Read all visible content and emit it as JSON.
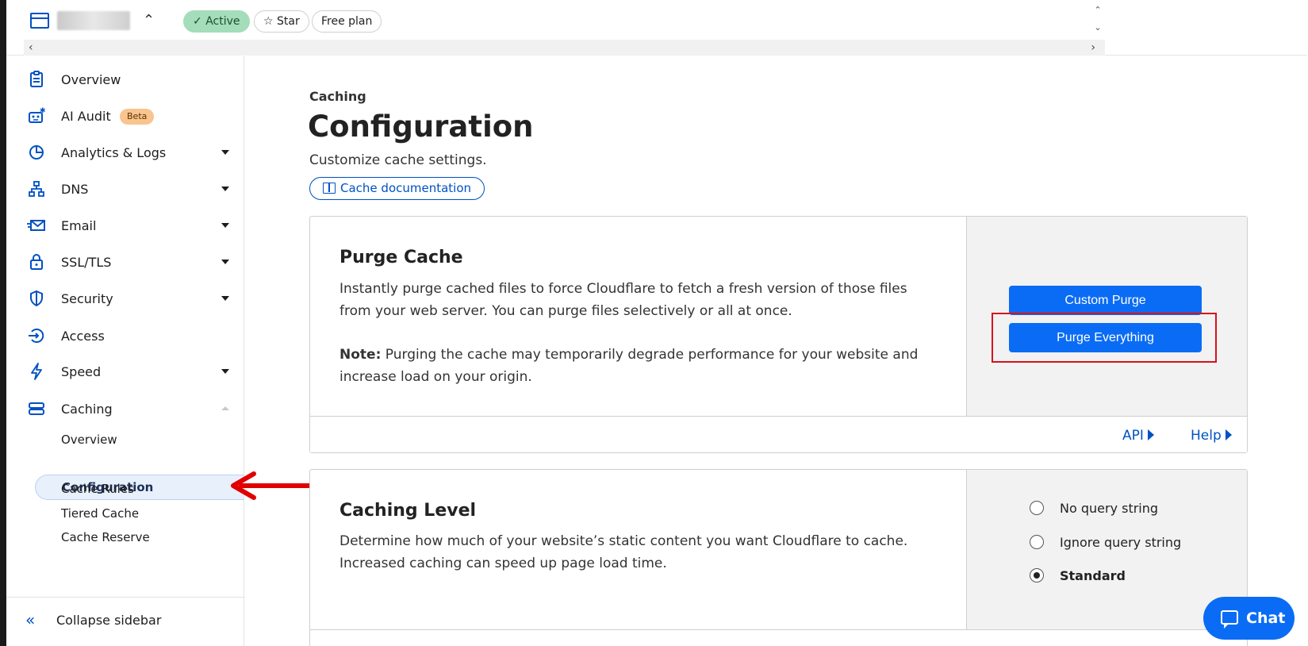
{
  "topbar": {
    "status_label": "Active",
    "star_label": "Star",
    "plan_label": "Free plan"
  },
  "sidebar": {
    "items": [
      {
        "label": "Overview",
        "icon": "clipboard-icon"
      },
      {
        "label": "AI Audit",
        "icon": "robot-icon",
        "badge": "Beta"
      },
      {
        "label": "Analytics & Logs",
        "icon": "pie-chart-icon"
      },
      {
        "label": "DNS",
        "icon": "network-icon"
      },
      {
        "label": "Email",
        "icon": "envelope-icon"
      },
      {
        "label": "SSL/TLS",
        "icon": "lock-icon"
      },
      {
        "label": "Security",
        "icon": "shield-icon"
      },
      {
        "label": "Access",
        "icon": "access-icon"
      },
      {
        "label": "Speed",
        "icon": "lightning-icon"
      },
      {
        "label": "Caching",
        "icon": "server-stack-icon"
      }
    ],
    "caching_sub": [
      "Overview",
      "Configuration",
      "Cache Rules",
      "Tiered Cache",
      "Cache Reserve"
    ],
    "collapse_label": "Collapse sidebar"
  },
  "header": {
    "eyebrow": "Caching",
    "title": "Configuration",
    "subtitle": "Customize cache settings.",
    "doc_button": "Cache documentation"
  },
  "purge_card": {
    "title": "Purge Cache",
    "description": "Instantly purge cached files to force Cloudflare to fetch a fresh version of those files from your web server. You can purge files selectively or all at once.",
    "note_label": "Note:",
    "note_text": " Purging the cache may temporarily degrade performance for your website and increase load on your origin.",
    "custom_purge": "Custom Purge",
    "purge_everything": "Purge Everything",
    "api_link": "API",
    "help_link": "Help"
  },
  "caching_level_card": {
    "title": "Caching Level",
    "description": "Determine how much of your website’s static content you want Cloudflare to cache. Increased caching can speed up page load time.",
    "options": [
      "No query string",
      "Ignore query string",
      "Standard"
    ],
    "selected": "Standard"
  },
  "chat": {
    "label": "Chat"
  },
  "colors": {
    "accent": "#0a6cf5",
    "annotation": "#d7111b",
    "active_pill": "#a4ddb9"
  }
}
